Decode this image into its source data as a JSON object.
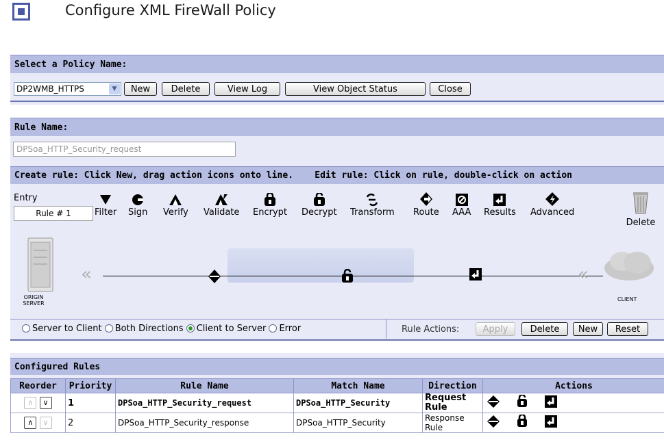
{
  "page": {
    "title": "Configure XML FireWall Policy"
  },
  "policy": {
    "section_label": "Select a Policy Name:",
    "selected_policy": "DP2WMB_HTTPS",
    "buttons": {
      "new": "New",
      "delete": "Delete",
      "view_log": "View Log",
      "view_object_status": "View Object Status",
      "close": "Close"
    }
  },
  "rule": {
    "section_label": "Rule Name:",
    "name_value": "DPSoa_HTTP_Security_request",
    "instructions": "Create rule: Click New, drag action icons onto line.    Edit rule: Click on rule, double-click on action",
    "entry_label": "Entry",
    "rule_number": "Rule # 1"
  },
  "palette": [
    {
      "label": "Filter",
      "icon": "filter-icon"
    },
    {
      "label": "Sign",
      "icon": "sign-icon"
    },
    {
      "label": "Verify",
      "icon": "verify-icon"
    },
    {
      "label": "Validate",
      "icon": "validate-icon"
    },
    {
      "label": "Encrypt",
      "icon": "encrypt-icon"
    },
    {
      "label": "Decrypt",
      "icon": "decrypt-icon"
    },
    {
      "label": "Transform",
      "icon": "transform-icon"
    },
    {
      "label": "Route",
      "icon": "route-icon"
    },
    {
      "label": "AAA",
      "icon": "aaa-icon"
    },
    {
      "label": "Results",
      "icon": "results-icon"
    },
    {
      "label": "Advanced",
      "icon": "advanced-icon"
    }
  ],
  "trash_label": "Delete",
  "diagram": {
    "origin_label": "ORIGIN\nSERVER",
    "client_label": "CLIENT"
  },
  "direction": {
    "options": [
      "Server to Client",
      "Both Directions",
      "Client to Server",
      "Error"
    ],
    "selected": "Client to Server",
    "actions_label": "Rule Actions:",
    "buttons": {
      "apply": "Apply",
      "delete": "Delete",
      "new": "New",
      "reset": "Reset"
    }
  },
  "configured": {
    "section_label": "Configured Rules",
    "columns": [
      "Reorder",
      "Priority",
      "Rule Name",
      "Match Name",
      "Direction",
      "Actions"
    ],
    "rows": [
      {
        "priority": "1",
        "rule_name": "DPSoa_HTTP_Security_request",
        "match_name": "DPSoa_HTTP_Security",
        "direction": "Request Rule",
        "bold": true
      },
      {
        "priority": "2",
        "rule_name": "DPSoa_HTTP_Security_response",
        "match_name": "DPSoa_HTTP_Security",
        "direction": "Response Rule",
        "bold": false
      }
    ]
  },
  "colors": {
    "band": "#b6bde3",
    "band_body": "#e8eaf8",
    "accent": "#4a58a8"
  }
}
